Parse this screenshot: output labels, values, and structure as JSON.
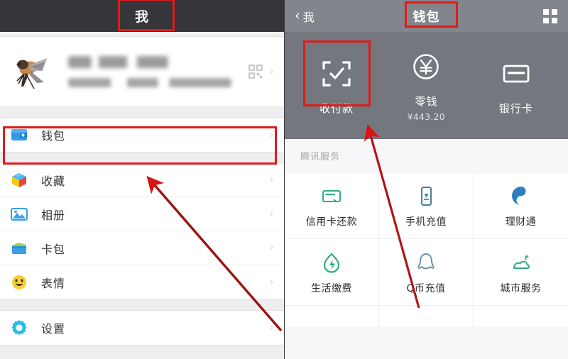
{
  "left": {
    "header": {
      "title": "我"
    },
    "profile": {
      "name_blurred": true,
      "id_blurred": true,
      "qr_icon": "qr-code-icon",
      "chevron": "›"
    },
    "menu_primary": [
      {
        "label": "钱包",
        "icon": "wallet-icon",
        "chevron": "›",
        "highlighted": true
      }
    ],
    "menu_group_two": [
      {
        "label": "收藏",
        "icon": "favorites-cube-icon",
        "chevron": "›"
      },
      {
        "label": "相册",
        "icon": "album-photo-icon",
        "chevron": "›"
      },
      {
        "label": "卡包",
        "icon": "card-package-icon",
        "chevron": "›"
      },
      {
        "label": "表情",
        "icon": "sticker-smiley-icon",
        "chevron": "›"
      }
    ],
    "menu_group_three": [
      {
        "label": "设置",
        "icon": "settings-gear-icon",
        "chevron": "›"
      }
    ]
  },
  "right": {
    "header": {
      "back_label": "我",
      "back_arrow": "‹",
      "title": "钱包",
      "grid_icon": "grid-menu-icon"
    },
    "wallet_tiles": [
      {
        "label": "收付款",
        "sub": "",
        "icon": "scan-pay-icon",
        "highlighted": true
      },
      {
        "label": "零钱",
        "sub": "¥443.20",
        "icon": "yuan-circle-icon"
      },
      {
        "label": "银行卡",
        "sub": "",
        "icon": "bank-card-icon"
      }
    ],
    "services": {
      "section_title": "腾讯服务",
      "items": [
        {
          "label": "信用卡还款",
          "icon": "credit-card-repay-icon"
        },
        {
          "label": "手机充值",
          "icon": "phone-topup-icon"
        },
        {
          "label": "理财通",
          "icon": "wealth-licaitong-icon"
        },
        {
          "label": "生活缴费",
          "icon": "utility-bill-icon"
        },
        {
          "label": "Q币充值",
          "icon": "qq-penguin-icon"
        },
        {
          "label": "城市服务",
          "icon": "city-service-icon"
        }
      ]
    }
  },
  "annotations": {
    "accent_color": "#e01b1b",
    "boxes": [
      {
        "name": "me-title-box"
      },
      {
        "name": "wallet-row-box"
      },
      {
        "name": "wallet-title-box"
      },
      {
        "name": "shoufukuan-box"
      }
    ],
    "arrows": [
      {
        "name": "arrow-to-wallet-row",
        "from": "bottom-right of left panel",
        "to": "钱包 row"
      },
      {
        "name": "arrow-to-shoufukuan",
        "from": "bottom of right panel",
        "to": "收付款 tile"
      }
    ]
  }
}
